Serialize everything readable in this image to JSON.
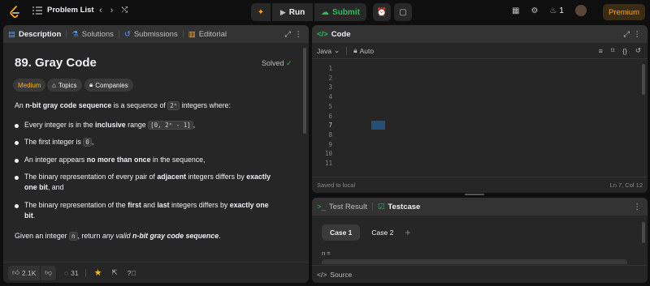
{
  "topbar": {
    "problem_list": "Problem List",
    "run": "Run",
    "submit": "Submit",
    "streak": "1",
    "premium": "Premium"
  },
  "left": {
    "tabs": [
      "Description",
      "Solutions",
      "Submissions",
      "Editorial"
    ],
    "title": "89. Gray Code",
    "status": "Solved",
    "difficulty": "Medium",
    "topics": "Topics",
    "companies": "Companies",
    "intro_a": "An ",
    "intro_b": "n-bit gray code sequence",
    "intro_c": " is a sequence of ",
    "intro_code": "2ⁿ",
    "intro_d": " integers where:",
    "b1_a": "Every integer is in the ",
    "b1_b": "inclusive",
    "b1_c": " range ",
    "b1_code": "[0, 2ⁿ - 1]",
    "b1_d": ",",
    "b2_a": "The first integer is ",
    "b2_code": "0",
    "b2_b": ",",
    "b3_a": "An integer appears ",
    "b3_b": "no more than once",
    "b3_c": " in the sequence,",
    "b4_a": "The binary representation of every pair of ",
    "b4_b": "adjacent",
    "b4_c": " integers differs by ",
    "b4_d": "exactly",
    "b4_e": "one bit",
    "b4_f": ", and",
    "b5_a": "The binary representation of the ",
    "b5_b": "first",
    "b5_c": " and ",
    "b5_d": "last",
    "b5_e": " integers differs by ",
    "b5_f": "exactly one",
    "b5_g": "bit",
    "b5_h": ".",
    "given_a": "Given an integer ",
    "given_code": "n",
    "given_b": ", return ",
    "given_c": "any valid",
    "given_d": "n-bit gray code sequence",
    "given_e": ".",
    "likes": "2.1K",
    "comments": "31"
  },
  "code_panel": {
    "title": "Code",
    "language": "Java",
    "mode": "Auto",
    "saved": "Saved to local",
    "cursor": "Ln 7, Col 12",
    "line_numbers": [
      "1",
      "2",
      "3",
      "4",
      "5",
      "6",
      "7",
      "8",
      "9",
      "10",
      "11"
    ]
  },
  "test_panel": {
    "tab_result": "Test Result",
    "tab_testcase": "Testcase",
    "case1": "Case 1",
    "case2": "Case 2",
    "add": "+",
    "var_label": "n =",
    "source": "Source"
  },
  "colors": {
    "accent": "#ffa116",
    "green": "#2cbb5d",
    "blue": "#4f9cf7",
    "panel": "#262626",
    "background": "#0f0f0f"
  }
}
